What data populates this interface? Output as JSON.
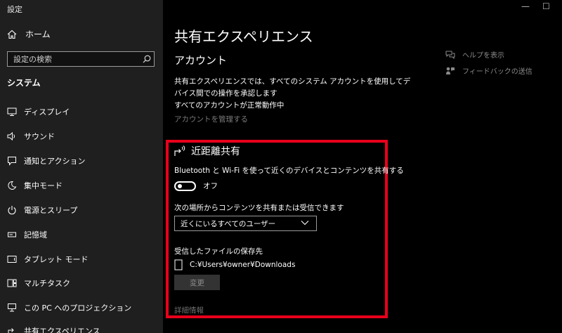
{
  "window": {
    "title": "設定",
    "minimize": "—",
    "maximize": "☐"
  },
  "sidebar": {
    "home_label": "ホーム",
    "search_placeholder": "設定の検索",
    "section_title": "システム",
    "items": [
      {
        "label": "ディスプレイ",
        "icon": "display-icon"
      },
      {
        "label": "サウンド",
        "icon": "sound-icon"
      },
      {
        "label": "通知とアクション",
        "icon": "notification-icon"
      },
      {
        "label": "集中モード",
        "icon": "moon-icon"
      },
      {
        "label": "電源とスリープ",
        "icon": "power-icon"
      },
      {
        "label": "記憶域",
        "icon": "storage-icon"
      },
      {
        "label": "タブレット モード",
        "icon": "tablet-icon"
      },
      {
        "label": "マルチタスク",
        "icon": "multitask-icon"
      },
      {
        "label": "この PC へのプロジェクション",
        "icon": "projection-icon"
      },
      {
        "label": "共有エクスペリエンス",
        "icon": "shared-icon"
      }
    ]
  },
  "main": {
    "title": "共有エクスペリエンス",
    "account_heading": "アカウント",
    "account_desc": "共有エクスペリエンスでは、すべてのシステム アカウントを使用してデバイス間での操作を承認します",
    "account_status": "すべてのアカウントが正常動作中",
    "manage_link": "アカウントを管理する",
    "nearby": {
      "title": "近距離共有",
      "bt_desc": "Bluetooth と Wi-Fi を使って近くのデバイスとコンテンツを共有する",
      "toggle_state": "オフ",
      "share_from_label": "次の場所からコンテンツを共有または受信できます",
      "share_from_value": "近くにいるすべてのユーザー",
      "save_location_label": "受信したファイルの保存先",
      "save_path": "C:¥Users¥owner¥Downloads",
      "change_button": "変更",
      "more_info": "詳細情報"
    }
  },
  "aside": {
    "help": "ヘルプを表示",
    "feedback": "フィードバックの送信"
  },
  "colors": {
    "highlight_frame": "#e8001c",
    "sidebar_bg": "#1f1f1f",
    "main_bg": "#000000"
  }
}
